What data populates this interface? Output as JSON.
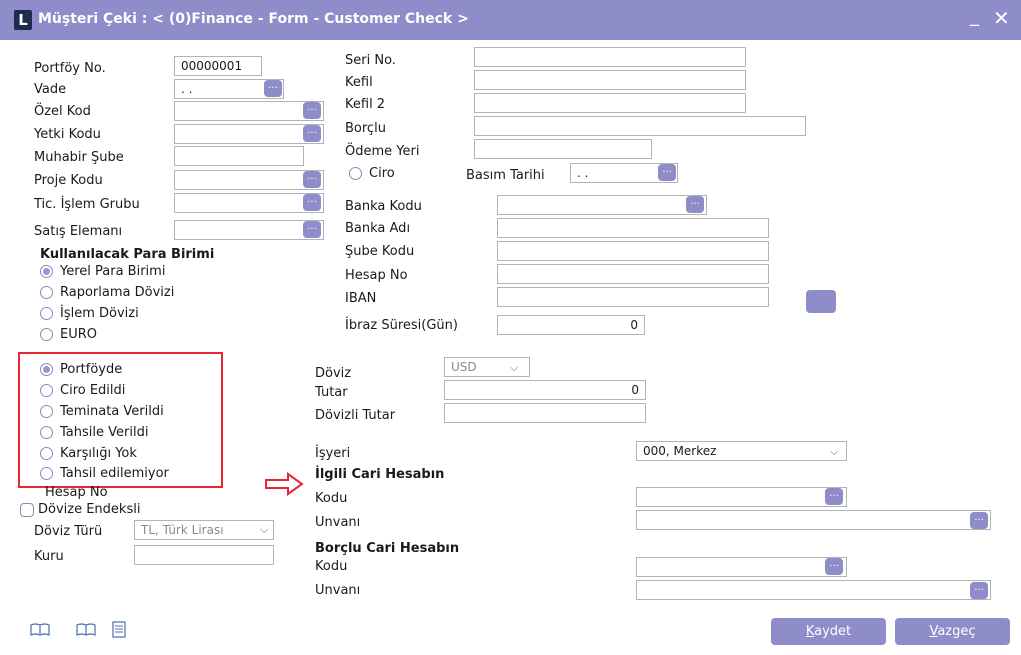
{
  "window": {
    "title": "Müşteri Çeki : < (0)Finance - Form - Customer Check >",
    "logo_letter": "L",
    "minimize": "_",
    "close": "✕"
  },
  "left_fields": {
    "portfoy_no_label": "Portföy No.",
    "portfoy_no_value": "00000001",
    "vade_label": "Vade",
    "vade_value": ". .",
    "ozel_kod_label": "Özel Kod",
    "yetki_kodu_label": "Yetki Kodu",
    "muhabir_sube_label": "Muhabir Şube",
    "proje_kodu_label": "Proje Kodu",
    "tic_islem_grubu_label": "Tic. İşlem Grubu",
    "satis_elemani_label": "Satış Elemanı",
    "ellipsis": "..."
  },
  "currency_group": {
    "title": "Kullanılacak Para Birimi",
    "options": [
      "Yerel Para Birimi",
      "Raporlama Dövizi",
      "İşlem Dövizi",
      "EURO"
    ],
    "selected": "Yerel Para Birimi"
  },
  "status_group": {
    "options": [
      "Portföyde",
      "Ciro Edildi",
      "Teminata Verildi",
      "Tahsile Verildi",
      "Karşılığı Yok",
      "Tahsil edilemiyor"
    ],
    "selected": "Portföyde"
  },
  "lower_left": {
    "hesap_no_label": "Hesap No",
    "dovize_endeksli_label": "Dövize Endeksli",
    "doviz_turu_label": "Döviz Türü",
    "doviz_turu_value": "TL, Türk Lirası",
    "kuru_label": "Kuru"
  },
  "right_fields": {
    "seri_no_label": "Seri No.",
    "kefil_label": "Kefil",
    "kefil2_label": "Kefil 2",
    "borclu_label": "Borçlu",
    "odeme_yeri_label": "Ödeme Yeri",
    "ciro_label": "Ciro",
    "basim_tarihi_label": "Basım Tarihi",
    "basim_tarihi_value": ". .",
    "banka_kodu_label": "Banka Kodu",
    "banka_adi_label": "Banka Adı",
    "sube_kodu_label": "Şube Kodu",
    "hesap_no_label": "Hesap No",
    "iban_label": "IBAN",
    "ibraz_suresi_label": "İbraz Süresi(Gün)",
    "ibraz_suresi_value": "0"
  },
  "amount_fields": {
    "doviz_label": "Döviz",
    "doviz_value": "USD",
    "tutar_label": "Tutar",
    "tutar_value": "0",
    "dovizli_tutar_label": "Dövizli Tutar"
  },
  "accounts": {
    "isyeri_label": "İşyeri",
    "isyeri_value": "000, Merkez",
    "ilgili_title": "İlgili Cari Hesabın",
    "kodu_label": "Kodu",
    "unvani_label": "Unvanı",
    "borclu_title": "Borçlu Cari Hesabın",
    "borclu_kodu_label": "Kodu",
    "borclu_unvani_label": "Unvanı"
  },
  "footer": {
    "save_prefix": "K",
    "save_rest": "aydet",
    "cancel_prefix": "V",
    "cancel_rest": "azgeç"
  },
  "colors": {
    "accent": "#8e8cc9",
    "highlight": "#e8262f"
  },
  "icons": [
    "book-icon",
    "book-icon",
    "document-icon",
    "ellipsis-button",
    "chevron-down-icon",
    "arrow-right-icon"
  ]
}
